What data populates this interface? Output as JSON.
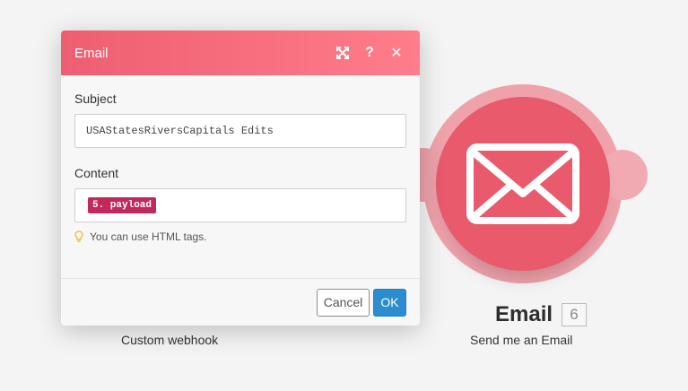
{
  "dialog": {
    "title": "Email",
    "icons": {
      "expand": "expand-icon",
      "help": "help-icon",
      "close": "close-icon"
    },
    "subject": {
      "label": "Subject",
      "value": "USAStatesRiversCapitals Edits"
    },
    "content": {
      "label": "Content",
      "token": "5. payload"
    },
    "hint": {
      "icon": "lightbulb-icon",
      "text": "You can use HTML tags."
    },
    "buttons": {
      "cancel": "Cancel",
      "ok": "OK"
    }
  },
  "scenario": {
    "webhook_module": {
      "label": "Custom webhook"
    },
    "email_module": {
      "icon": "envelope-icon",
      "title": "Email",
      "badge": "6",
      "subtitle": "Send me an Email",
      "color": "#e85a6c"
    }
  },
  "colors": {
    "header_gradient_start": "#ee5e72",
    "header_gradient_end": "#ff7d8a",
    "token_pill": "#c2285a",
    "ok_button": "#2b8ccf"
  }
}
